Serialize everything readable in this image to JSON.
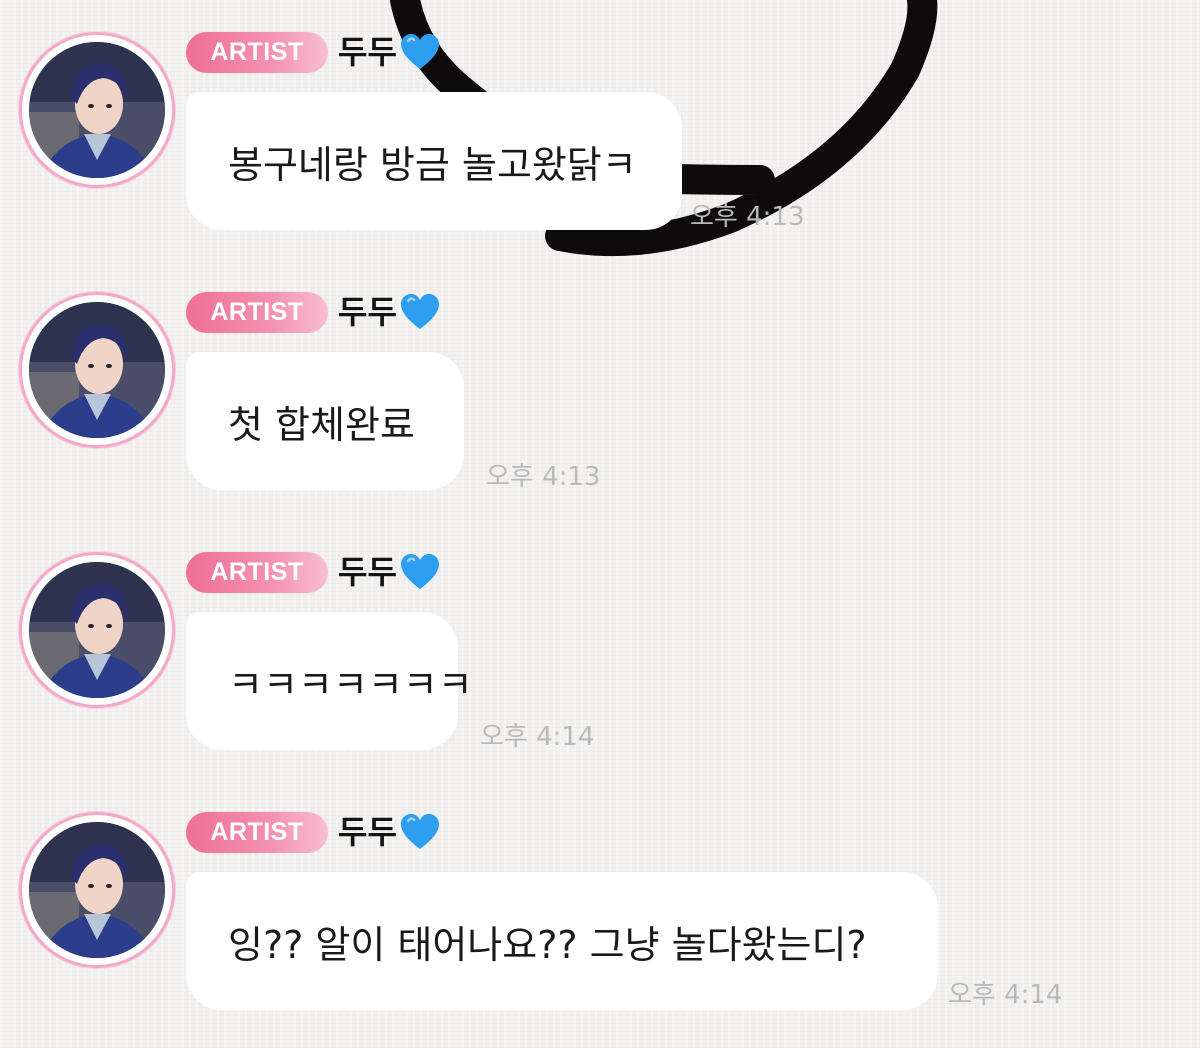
{
  "theme": {
    "badge_gradient": [
      "#ef6f95",
      "#f8bfd2"
    ],
    "avatar_ring": "#f4a9c7",
    "heart": "#2d9ef0",
    "timestamp": "#b9b9b9"
  },
  "messages": [
    {
      "badge": "ARTIST",
      "sender": "두두",
      "sender_icon": "blue-heart-icon",
      "text": "봉구네랑 방금 놀고왔닭ㅋ",
      "time": "오후 4:13"
    },
    {
      "badge": "ARTIST",
      "sender": "두두",
      "sender_icon": "blue-heart-icon",
      "text": "첫 합체완료",
      "time": "오후 4:13"
    },
    {
      "badge": "ARTIST",
      "sender": "두두",
      "sender_icon": "blue-heart-icon",
      "text": "ㅋㅋㅋㅋㅋㅋㅋ",
      "time": "오후 4:14"
    },
    {
      "badge": "ARTIST",
      "sender": "두두",
      "sender_icon": "blue-heart-icon",
      "text": "잉?? 알이 태어나요?? 그냥 놀다왔는디?",
      "time": "오후 4:14"
    }
  ]
}
